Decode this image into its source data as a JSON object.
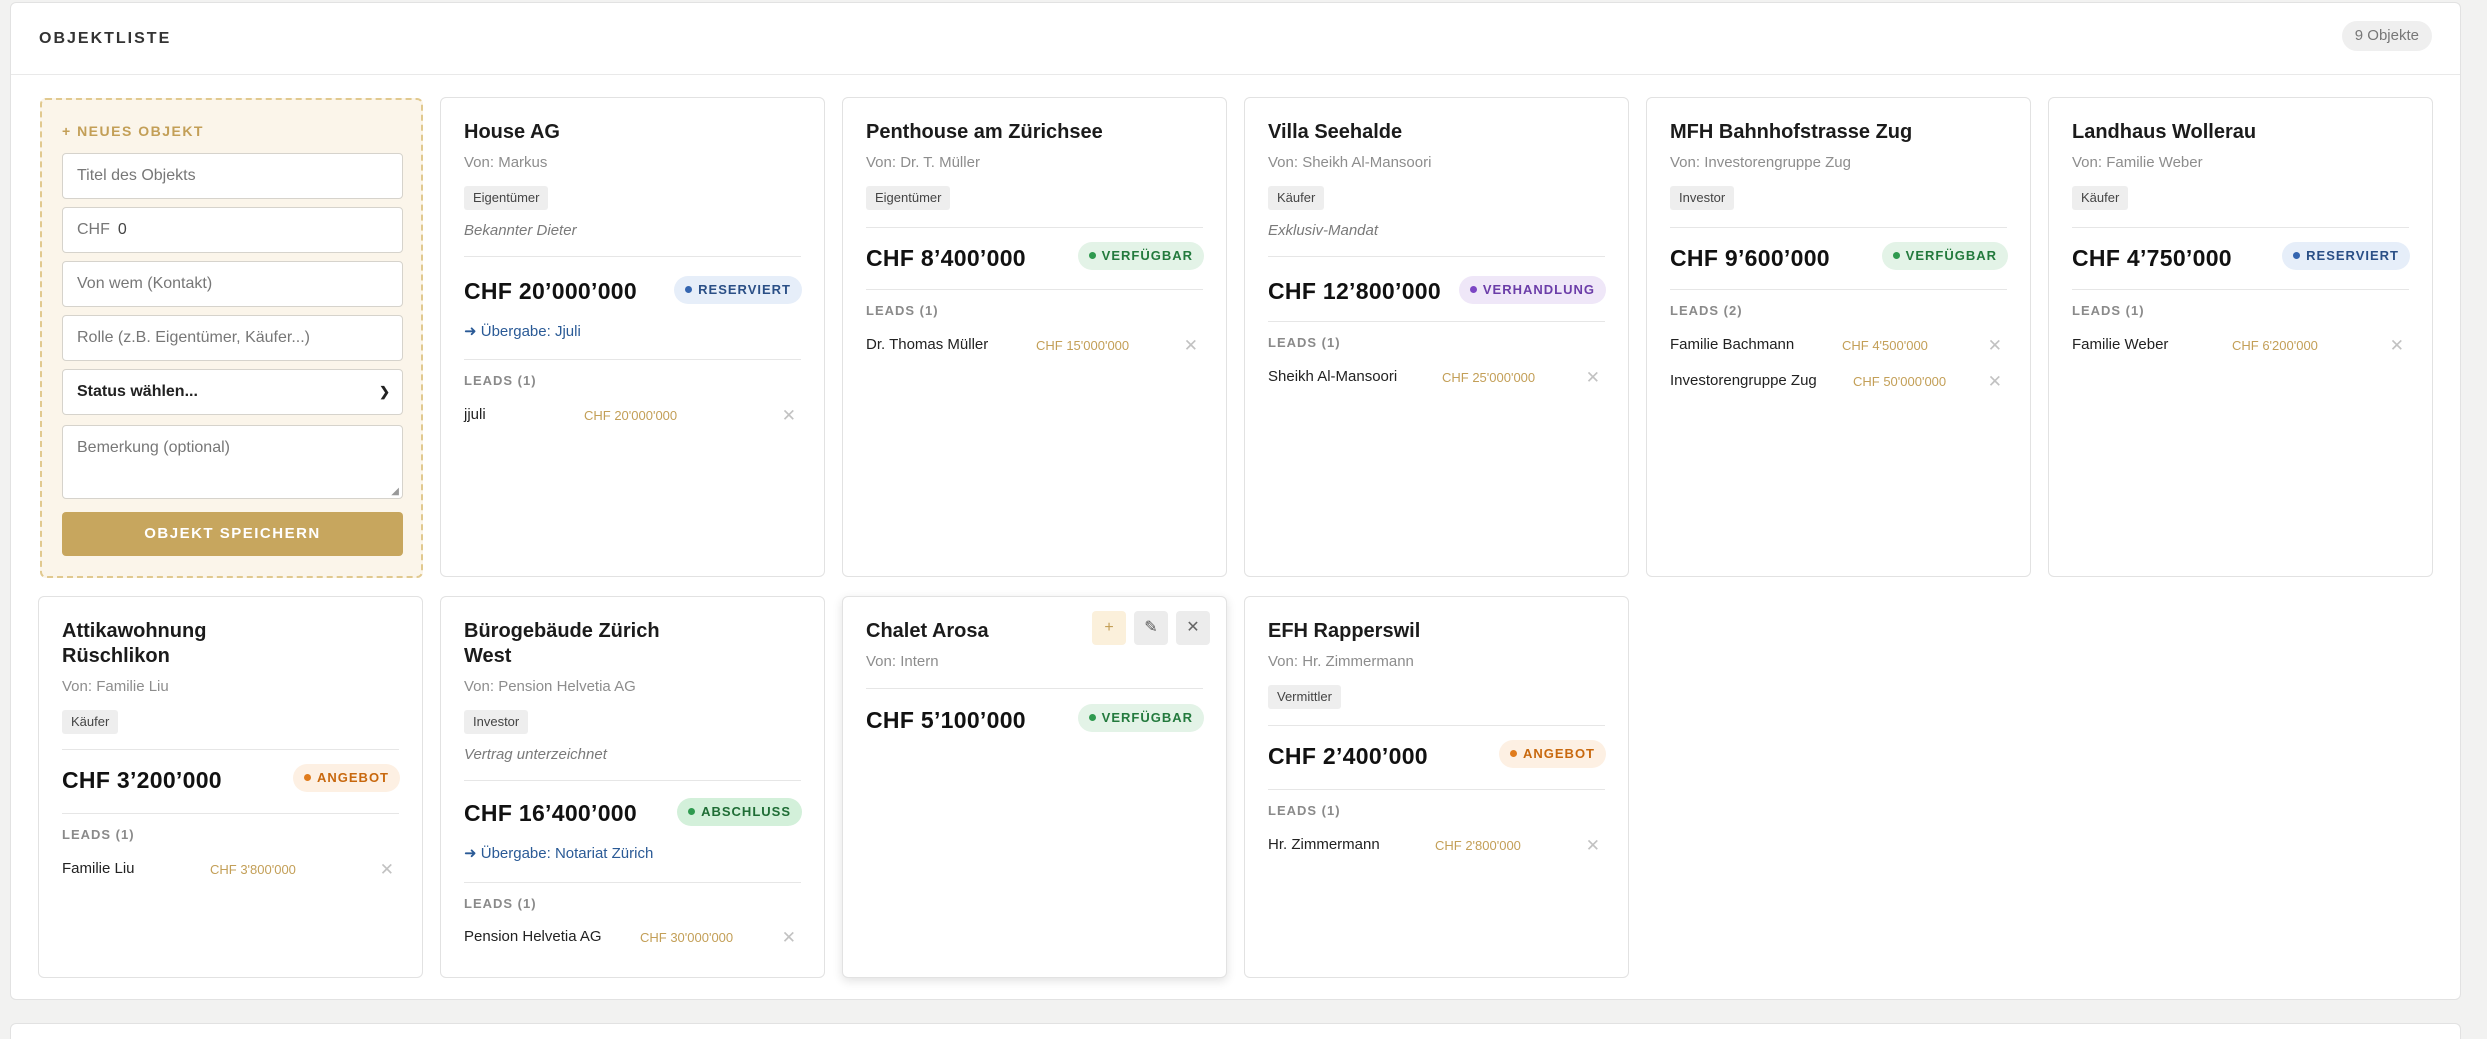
{
  "header": {
    "title": "OBJEKTLISTE",
    "count": "9 Objekte"
  },
  "new_object": {
    "heading": "+ NEUES OBJEKT",
    "title_placeholder": "Titel des Objekts",
    "price_prefix": "CHF",
    "price_value": "0",
    "contact_placeholder": "Von wem (Kontakt)",
    "role_placeholder": "Rolle (z.B. Eigentümer, Käufer...)",
    "status_select": "Status wählen...",
    "note_placeholder": "Bemerkung (optional)",
    "save_label": "OBJEKT SPEICHERN"
  },
  "leads_heading": [
    "LEADS (1)",
    "LEADS (2)"
  ],
  "objects": [
    {
      "title": "House AG",
      "from": "Von: Markus",
      "role": "Eigentümer",
      "note": "Bekannter Dieter",
      "price": "CHF 20’000’000",
      "status": "RESERVIERT",
      "handover": "➜ Übergabe: Jjuli",
      "leads_label": "LEADS (1)",
      "leads": [
        {
          "name": "jjuli",
          "amount": "CHF 20'000'000"
        }
      ]
    },
    {
      "title": "Penthouse am Zürichsee",
      "from": "Von: Dr. T. Müller",
      "role": "Eigentümer",
      "price": "CHF 8’400’000",
      "status": "VERFÜGBAR",
      "leads_label": "LEADS (1)",
      "leads": [
        {
          "name": "Dr. Thomas Müller",
          "amount": "CHF 15'000'000"
        }
      ]
    },
    {
      "title": "Villa Seehalde",
      "from": "Von: Sheikh Al-Mansoori",
      "role": "Käufer",
      "note": "Exklusiv-Mandat",
      "price": "CHF 12’800’000",
      "status": "VERHANDLUNG",
      "leads_label": "LEADS (1)",
      "leads": [
        {
          "name": "Sheikh Al-Mansoori",
          "amount": "CHF 25'000'000"
        }
      ]
    },
    {
      "title": "MFH Bahnhofstrasse Zug",
      "from": "Von: Investorengruppe Zug",
      "role": "Investor",
      "price": "CHF 9’600’000",
      "status": "VERFÜGBAR",
      "leads_label": "LEADS (2)",
      "leads": [
        {
          "name": "Familie Bachmann",
          "amount": "CHF 4'500'000"
        },
        {
          "name": "Investorengruppe Zug",
          "amount": "CHF 50'000'000"
        }
      ]
    },
    {
      "title": "Landhaus Wollerau",
      "from": "Von: Familie Weber",
      "role": "Käufer",
      "price": "CHF 4’750’000",
      "status": "RESERVIERT",
      "leads_label": "LEADS (1)",
      "leads": [
        {
          "name": "Familie Weber",
          "amount": "CHF 6'200'000"
        }
      ]
    },
    {
      "title_line1": "Attikawohnung",
      "title_line2": "Rüschlikon",
      "from": "Von: Familie Liu",
      "role": "Käufer",
      "price": "CHF 3’200’000",
      "status": "ANGEBOT",
      "leads_label": "LEADS (1)",
      "leads": [
        {
          "name": "Familie Liu",
          "amount": "CHF 3'800'000"
        }
      ]
    },
    {
      "title_line1": "Bürogebäude Zürich",
      "title_line2": "West",
      "from": "Von: Pension Helvetia AG",
      "role": "Investor",
      "note": "Vertrag unterzeichnet",
      "price": "CHF 16’400’000",
      "status": "ABSCHLUSS",
      "handover": "➜ Übergabe: Notariat Zürich",
      "leads_label": "LEADS (1)",
      "leads": [
        {
          "name": "Pension Helvetia AG",
          "amount": "CHF 30'000'000"
        }
      ]
    },
    {
      "title": "Chalet Arosa",
      "from": "Von: Intern",
      "price": "CHF 5’100’000",
      "status": "VERFÜGBAR",
      "actions": {
        "add": "+",
        "edit": "✎",
        "delete": "✕"
      }
    },
    {
      "title": "EFH Rapperswil",
      "from": "Von: Hr. Zimmermann",
      "role": "Vermittler",
      "price": "CHF 2’400’000",
      "status": "ANGEBOT",
      "leads_label": "LEADS (1)",
      "leads": [
        {
          "name": "Hr. Zimmermann",
          "amount": "CHF 2'800'000"
        }
      ]
    }
  ],
  "remove_glyph": "✕",
  "colors": {
    "accent_gold": "#c7a65e",
    "available": "#237a3d",
    "reserved": "#2a4f86",
    "negotiation": "#6b3da8",
    "offer": "#c8680e",
    "closing": "#1f6d35"
  }
}
